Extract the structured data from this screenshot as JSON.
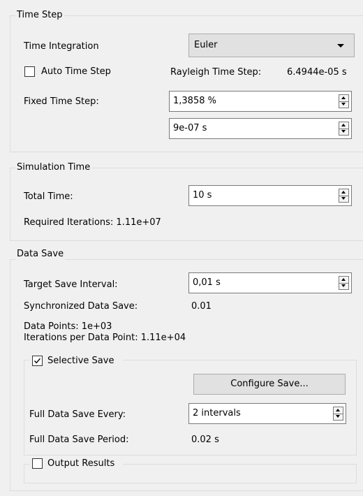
{
  "time_step": {
    "title": "Time Step",
    "integration_label": "Time Integration",
    "integration_value": "Euler",
    "auto_time_step_label": "Auto Time Step",
    "auto_time_step_checked": false,
    "rayleigh_label": "Rayleigh Time Step:",
    "rayleigh_value": "6.4944e-05 s",
    "fixed_label": "Fixed Time Step:",
    "fixed_percent_value": "1,3858 %",
    "fixed_seconds_value": "9e-07 s"
  },
  "simulation_time": {
    "title": "Simulation Time",
    "total_label": "Total Time:",
    "total_value": "10 s",
    "required_iterations": "Required Iterations: 1.11e+07"
  },
  "data_save": {
    "title": "Data Save",
    "target_interval_label": "Target Save Interval:",
    "target_interval_value": "0,01 s",
    "synchronized_label": "Synchronized Data Save:",
    "synchronized_value": "0.01",
    "data_points": "Data Points: 1e+03",
    "iterations_per_point": "Iterations per Data Point: 1.11e+04",
    "selective_save": {
      "label": "Selective Save",
      "checked": true,
      "configure_button": "Configure Save...",
      "full_every_label": "Full Data Save Every:",
      "full_every_value": "2 intervals",
      "full_period_label": "Full Data Save Period:",
      "full_period_value": "0.02 s"
    },
    "output_results": {
      "label": "Output Results",
      "checked": false
    }
  }
}
